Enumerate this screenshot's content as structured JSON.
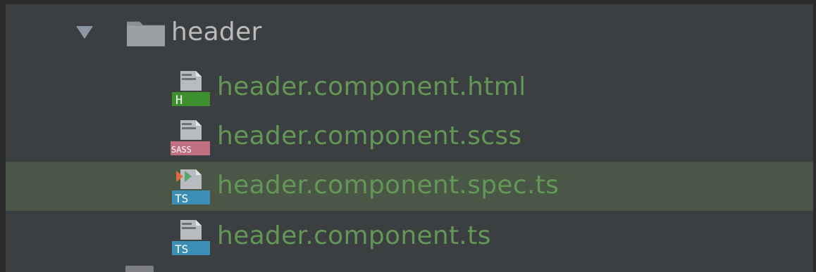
{
  "tree": {
    "folder": {
      "label": "header",
      "expanded": true,
      "icon": "folder-icon"
    },
    "files": [
      {
        "label": "header.component.html",
        "icon": "html-file-icon",
        "badge": "H",
        "badge_color": "#3d8f2f",
        "selected": false
      },
      {
        "label": "header.component.scss",
        "icon": "sass-file-icon",
        "badge": "SASS",
        "badge_color": "#c6538c",
        "selected": false
      },
      {
        "label": "header.component.spec.ts",
        "icon": "typescript-test-file-icon",
        "badge": "TS",
        "badge_color": "#3c8eb5",
        "selected": true
      },
      {
        "label": "header.component.ts",
        "icon": "typescript-file-icon",
        "badge": "TS",
        "badge_color": "#3c8eb5",
        "selected": false
      }
    ]
  },
  "colors": {
    "background": "#3c3f41",
    "selection": "#4a5747",
    "file_text": "#629755",
    "folder_text": "#bbbbbb"
  }
}
